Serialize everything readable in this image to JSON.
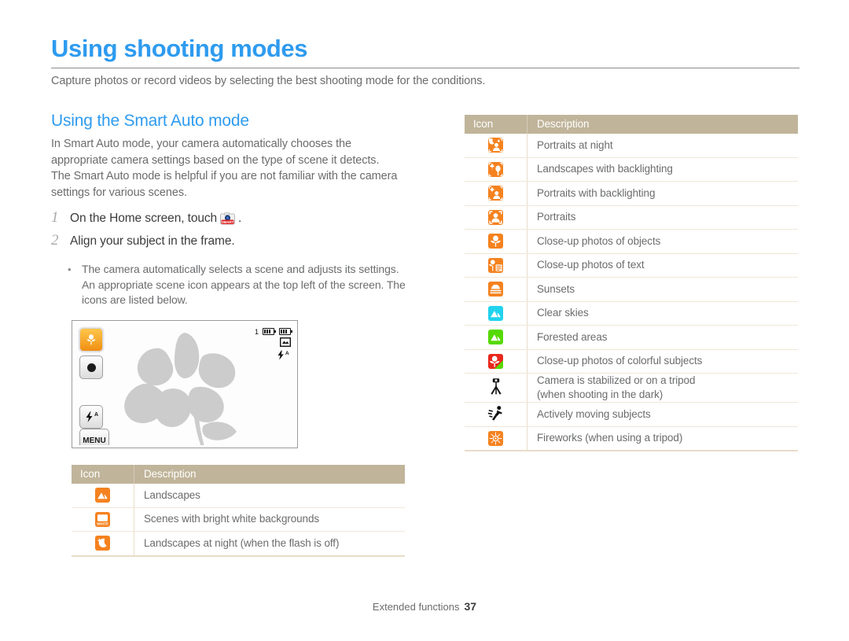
{
  "document": {
    "title": "Using shooting modes",
    "intro": "Capture photos or record videos by selecting the best shooting mode for the conditions.",
    "section_title": "Using the Smart Auto mode",
    "body_paragraph": "In Smart Auto mode, your camera automatically chooses the appropriate camera settings based on the type of scene it detects. The Smart Auto mode is helpful if you are not familiar with the camera settings for various scenes.",
    "steps": [
      {
        "num": "1",
        "text_before": "On the Home screen, touch",
        "icon": "smart-auto-badge-icon",
        "text_after": "."
      },
      {
        "num": "2",
        "text_before": "Align your subject in the frame.",
        "icon": "",
        "text_after": ""
      }
    ],
    "bullet": "The camera automatically selects a scene and adjusts its settings. An appropriate scene icon appears at the top left of the screen. The icons are listed below.",
    "footer": {
      "label": "Extended functions",
      "page": "37"
    },
    "colors": {
      "heading_blue": "#2e9bef",
      "table_header_tan": "#c0b49a",
      "icon_orange": "#f5821f",
      "icon_cyan": "#22d3ee",
      "icon_green": "#56d900",
      "icon_red": "#e8281e",
      "body_gray": "#6b6c6e"
    }
  },
  "camera_preview": {
    "counter": "1",
    "left_buttons": [
      {
        "name": "shooting-mode-button",
        "label": "",
        "icon": "macro-flower-icon",
        "style": "mode"
      },
      {
        "name": "record-button",
        "label": "",
        "icon": "record-dot-icon",
        "style": "plain"
      },
      {
        "name": "flash-button",
        "label": "",
        "icon": "flash-auto-icon",
        "style": "plain"
      },
      {
        "name": "menu-button",
        "label": "MENU",
        "icon": "menu-icon",
        "style": "plain"
      }
    ],
    "status_icons": [
      {
        "name": "memory-card-icon",
        "label": "memory-card"
      },
      {
        "name": "battery-icon",
        "label": "battery-full"
      },
      {
        "name": "image-size-icon",
        "label": "image-size"
      },
      {
        "name": "flash-auto-icon",
        "label": "flash-auto"
      }
    ]
  },
  "table_left": {
    "headers": {
      "icon": "Icon",
      "description": "Description"
    },
    "rows": [
      {
        "icon": "landscape-icon",
        "icon_kind": "landscape",
        "color": "#f5821f",
        "description": "Landscapes"
      },
      {
        "icon": "white-background-icon",
        "icon_kind": "white",
        "color": "#f5821f",
        "description": "Scenes with bright white backgrounds"
      },
      {
        "icon": "night-landscape-icon",
        "icon_kind": "night",
        "color": "#f5821f",
        "description": "Landscapes at night (when the flash is off)"
      }
    ]
  },
  "table_right": {
    "headers": {
      "icon": "Icon",
      "description": "Description"
    },
    "rows": [
      {
        "icon": "night-portrait-icon",
        "icon_kind": "nightportrait",
        "color": "#f5821f",
        "description": "Portraits at night"
      },
      {
        "icon": "backlight-landscape-icon",
        "icon_kind": "backtree",
        "color": "#f5821f",
        "description": "Landscapes with backlighting"
      },
      {
        "icon": "backlight-portrait-icon",
        "icon_kind": "backportrait",
        "color": "#f5821f",
        "description": "Portraits with backlighting"
      },
      {
        "icon": "portrait-icon",
        "icon_kind": "portrait",
        "color": "#f5821f",
        "description": "Portraits"
      },
      {
        "icon": "macro-icon",
        "icon_kind": "macro",
        "color": "#f5821f",
        "description": "Close-up photos of objects"
      },
      {
        "icon": "macro-text-icon",
        "icon_kind": "macrotext",
        "color": "#f5821f",
        "description": "Close-up photos of text"
      },
      {
        "icon": "sunset-icon",
        "icon_kind": "sunset",
        "color": "#f5821f",
        "description": "Sunsets"
      },
      {
        "icon": "clear-sky-icon",
        "icon_kind": "landscape",
        "color": "#22d3ee",
        "description": "Clear skies"
      },
      {
        "icon": "forest-icon",
        "icon_kind": "landscape",
        "color": "#56d900",
        "description": "Forested areas"
      },
      {
        "icon": "macro-color-icon",
        "icon_kind": "macrocolor",
        "color": "#e8281e",
        "description": "Close-up photos of colorful subjects"
      },
      {
        "icon": "tripod-icon",
        "icon_kind": "tripod",
        "color": "#111111",
        "description": "Camera is stabilized or on a tripod",
        "description_line2": "(when shooting in the dark)"
      },
      {
        "icon": "action-icon",
        "icon_kind": "action",
        "color": "#111111",
        "description": "Actively moving subjects"
      },
      {
        "icon": "fireworks-icon",
        "icon_kind": "fireworks",
        "color": "#f5821f",
        "description": "Fireworks (when using a tripod)"
      }
    ]
  }
}
